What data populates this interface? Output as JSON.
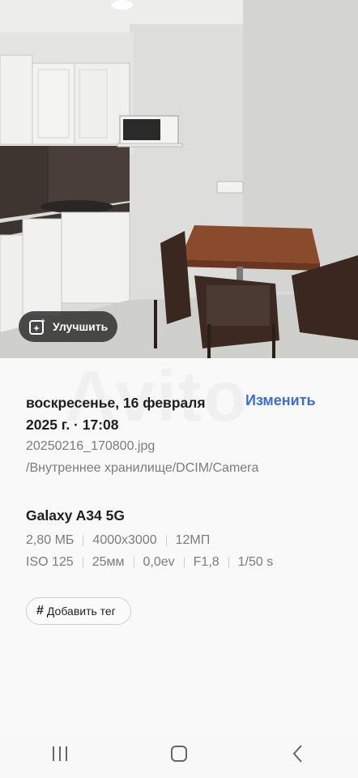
{
  "photo": {
    "description_icon": "kitchen-photo",
    "enhance_button": {
      "label": "Улучшить",
      "icon": "sparkle-icon"
    }
  },
  "details": {
    "date_line1": "воскресенье, 16 февраля",
    "date_line2": "2025 г. · 17:08",
    "edit_label": "Изменить",
    "filename": "20250216_170800.jpg",
    "path": "/Внутреннее хранилище/DCIM/Camera",
    "device": "Galaxy A34 5G",
    "file_specs": [
      "2,80 МБ",
      "4000x3000",
      "12МП"
    ],
    "camera_specs": [
      "ISO 125",
      "25мм",
      "0,0ev",
      "F1,8",
      "1/50 s"
    ],
    "add_tag_label": "Добавить тег",
    "watermark": "Avito"
  },
  "navbar": {
    "recents": "recents-icon",
    "home": "home-icon",
    "back": "back-icon"
  },
  "colors": {
    "accent": "#3a6fd0",
    "secondary_text": "#7c7c7c",
    "background": "#f9f9f9"
  }
}
